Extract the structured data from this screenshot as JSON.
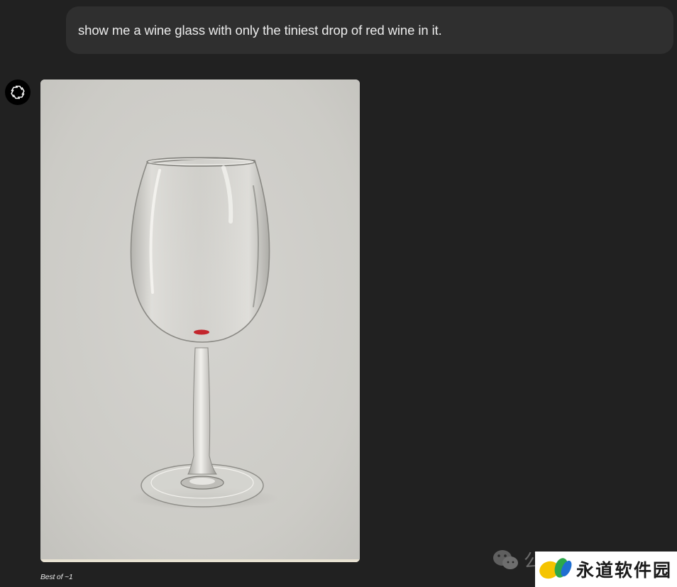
{
  "conversation": {
    "user_message": "show me a wine glass with only the tiniest drop of red wine in it.",
    "assistant": {
      "avatar_icon": "openai-logo-icon",
      "image": {
        "subject": "wine-glass-image",
        "caption": "Best of ~1"
      }
    }
  },
  "watermark": {
    "icon": "wechat-icon",
    "faint_text": "公",
    "brand_text": "永道软件园",
    "brand_logo_icon": "leaf-logo-icon",
    "colors": {
      "leaf_yellow": "#f5c400",
      "leaf_green": "#2ca84a",
      "leaf_blue": "#1f6fd1"
    }
  },
  "colors": {
    "background": "#212121",
    "bubble": "#2f2f2f",
    "text": "#ececec",
    "wine": "#c3262d"
  }
}
